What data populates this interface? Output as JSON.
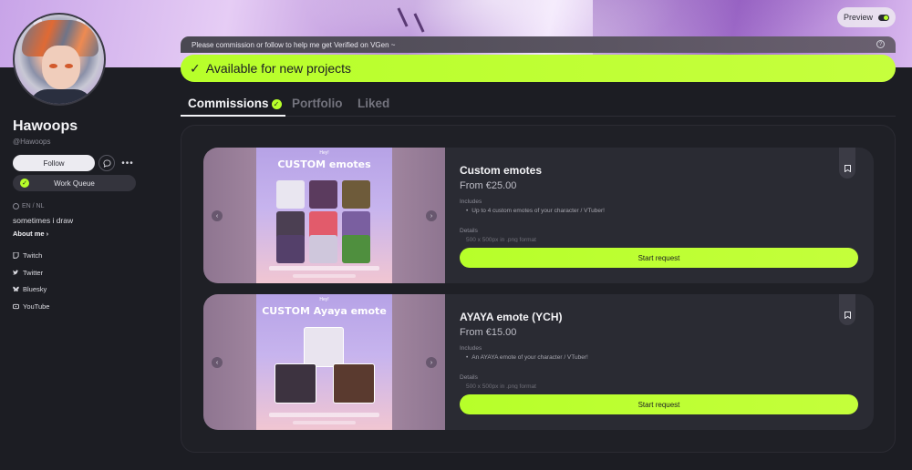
{
  "header": {
    "preview_label": "Preview"
  },
  "profile": {
    "name": "Hawoops",
    "handle": "@Hawoops",
    "follow_label": "Follow",
    "more_label": "•••",
    "work_queue_label": "Work Queue",
    "languages": "EN / NL",
    "bio": "sometimes i draw",
    "about_label": "About me",
    "socials": [
      {
        "label": "Twitch",
        "icon": "twitch-icon"
      },
      {
        "label": "Twitter",
        "icon": "twitter-icon"
      },
      {
        "label": "Bluesky",
        "icon": "bluesky-icon"
      },
      {
        "label": "YouTube",
        "icon": "youtube-icon"
      }
    ]
  },
  "notice": {
    "message": "Please commission or follow to help me get Verified on VGen ~",
    "help_icon": "?"
  },
  "availability": {
    "label": "Available for new projects"
  },
  "tabs": [
    {
      "label": "Commissions",
      "active": true
    },
    {
      "label": "Portfolio",
      "active": false
    },
    {
      "label": "Liked",
      "active": false
    }
  ],
  "commissions": [
    {
      "title": "Custom emotes",
      "price": "From €25.00",
      "includes_label": "Includes",
      "includes_item": "Up to 4 custom emotes of your character / VTuber!",
      "details_label": "Details",
      "details_item": "500 x 500px in .png format",
      "cta": "Start request",
      "poster_title": "CUSTOM emotes",
      "poster_small": "Hey!"
    },
    {
      "title": "AYAYA emote (YCH)",
      "price": "From €15.00",
      "includes_label": "Includes",
      "includes_item": "An AYAYA emote of your character / VTuber!",
      "details_label": "Details",
      "details_item": "500 x 500px in .png format",
      "cta": "Start request",
      "poster_title": "CUSTOM Ayaya emote",
      "poster_small": "Hey!"
    }
  ],
  "colors": {
    "accent": "#b7ff2a",
    "background": "#1c1d23",
    "card": "#2a2b33"
  }
}
